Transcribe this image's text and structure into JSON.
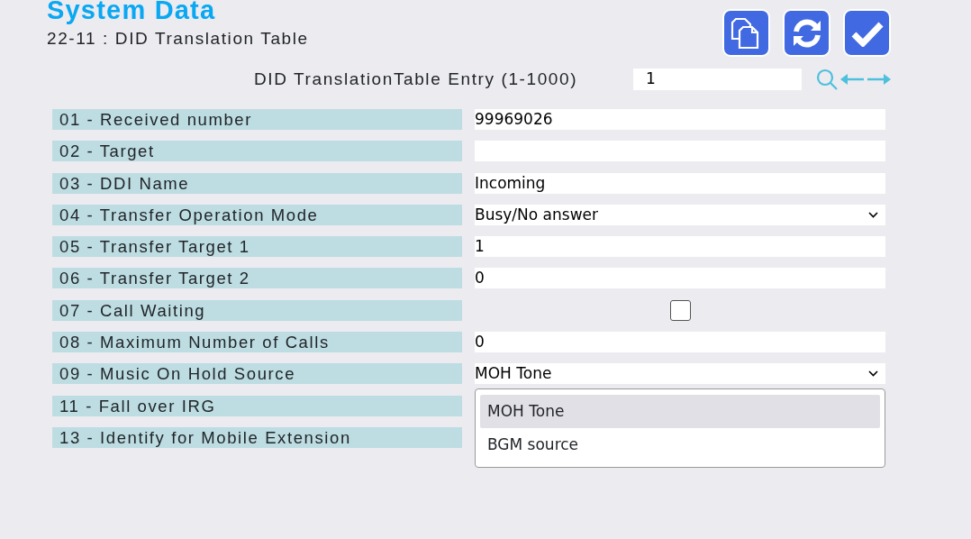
{
  "header": {
    "title": "System Data",
    "subtitle": "22-11 : DID Translation Table"
  },
  "toolbar": [
    {
      "kind": "copy"
    },
    {
      "kind": "refresh"
    },
    {
      "kind": "apply"
    }
  ],
  "entry": {
    "label": "DID TranslationTable Entry (1-1000)",
    "value": "1"
  },
  "rows": [
    {
      "label": "01 - Received number",
      "kind": "text",
      "value": "99969026"
    },
    {
      "label": "02 - Target",
      "kind": "text",
      "value": ""
    },
    {
      "label": "03 - DDI Name",
      "kind": "text",
      "value": "Incoming"
    },
    {
      "label": "04 - Transfer Operation Mode",
      "kind": "select",
      "value": "Busy/No answer"
    },
    {
      "label": "05 - Transfer Target 1",
      "kind": "text",
      "value": "1"
    },
    {
      "label": "06 - Transfer Target 2",
      "kind": "text",
      "value": "0"
    },
    {
      "label": "07 - Call Waiting",
      "kind": "checkbox",
      "checked": false
    },
    {
      "label": "08 - Maximum Number of Calls",
      "kind": "text",
      "value": "0"
    },
    {
      "label": "09 - Music On Hold Source",
      "kind": "select",
      "value": "MOH Tone",
      "open": true,
      "options": [
        {
          "label": "MOH Tone",
          "selected": true
        },
        {
          "label": "BGM source",
          "selected": false
        }
      ]
    },
    {
      "label": "11 - Fall over IRG",
      "kind": "hidden"
    },
    {
      "label": "13 - Identify for Mobile Extension",
      "kind": "hidden"
    }
  ]
}
